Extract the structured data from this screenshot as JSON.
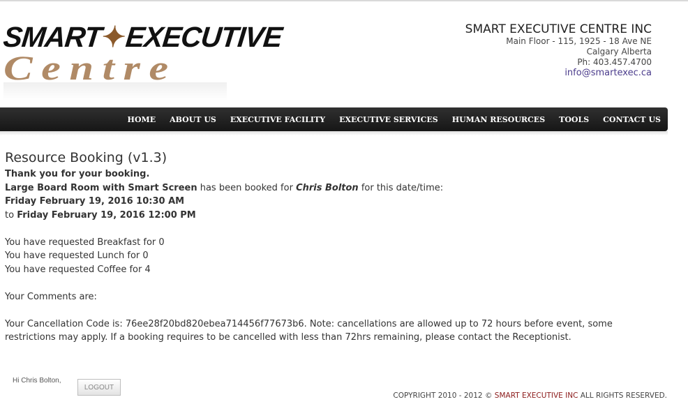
{
  "logo": {
    "line1_a": "SMART",
    "leaf": "✦",
    "line1_b": "EXECUTIVE",
    "line2": "Centre"
  },
  "company": {
    "name": "SMART EXECUTIVE CENTRE INC",
    "address1": "Main Floor - 115, 1925 - 18 Ave NE",
    "address2": "Calgary Alberta",
    "phone": "Ph: 403.457.4700",
    "email": "info@smartexec.ca"
  },
  "nav": [
    "HOME",
    "ABOUT US",
    "EXECUTIVE FACILITY",
    "EXECUTIVE SERVICES",
    "HUMAN RESOURCES",
    "TOOLS",
    "CONTACT US"
  ],
  "content": {
    "title": "Resource Booking (v1.3)",
    "thanks": "Thank you for your booking.",
    "resource": "Large Board Room with Smart Screen",
    "booked_for_text": " has been booked for ",
    "booked_name": "Chris Bolton",
    "datetime_text": " for this date/time:",
    "start": "Friday February 19, 2016 10:30 AM",
    "to_text": "to ",
    "end": "Friday February 19, 2016 12:00 PM",
    "req_breakfast": "You have requested Breakfast for 0",
    "req_lunch": "You have requested Lunch for 0",
    "req_coffee": "You have requested Coffee for 4",
    "comments": "Your Comments are:",
    "cancellation": "Your Cancellation Code is: 76ee28f20bd820ebea714456f77673b6. Note: cancellations are allowed up to 72 hours before event, some restrictions may apply. If a booking requires to be cancelled with less than 72hrs remaining, please contact the Receptionist."
  },
  "footer": {
    "greeting": "Hi Chris Bolton,",
    "logout": "LOGOUT",
    "copyright_pre": "COPYRIGHT 2010 - 2012 © ",
    "copyright_brand": "SMART EXECUTIVE INC",
    "copyright_post": " ALL RIGHTS RESERVED."
  }
}
